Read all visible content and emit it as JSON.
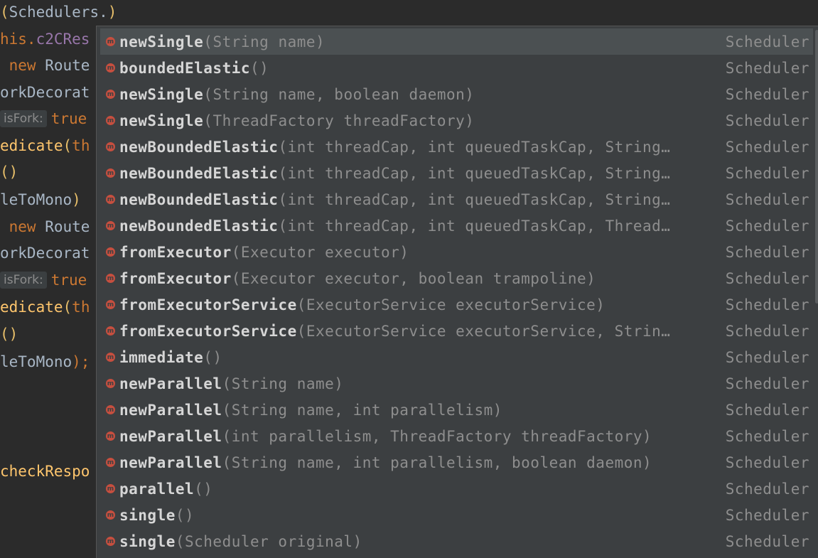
{
  "editor": {
    "lines": [
      {
        "id": "l1",
        "parts": [
          {
            "t": "(",
            "c": "c-paren"
          },
          {
            "t": "Schedulers.",
            "c": "c-plain"
          },
          {
            "t": ")",
            "c": "c-paren"
          }
        ]
      },
      {
        "id": "l2",
        "parts": [
          {
            "t": "his.",
            "c": "c-kw"
          },
          {
            "t": "c2CRes",
            "c": "c-field"
          }
        ]
      },
      {
        "id": "l3",
        "parts": [
          {
            "t": " new ",
            "c": "c-kw"
          },
          {
            "t": "Route",
            "c": "c-plain"
          }
        ]
      },
      {
        "id": "l4",
        "parts": [
          {
            "t": "orkDecorat",
            "c": "c-plain"
          }
        ]
      },
      {
        "id": "l5",
        "inlay": "isFork:",
        "parts": [
          {
            "t": "true",
            "c": "c-kw"
          }
        ]
      },
      {
        "id": "l6",
        "parts": [
          {
            "t": "edicate",
            "c": "c-method"
          },
          {
            "t": "(",
            "c": "c-paren"
          },
          {
            "t": "th",
            "c": "c-kw"
          }
        ]
      },
      {
        "id": "l7",
        "parts": [
          {
            "t": "()",
            "c": "c-paren"
          }
        ]
      },
      {
        "id": "l8",
        "parts": [
          {
            "t": "leToMono",
            "c": "c-plain"
          },
          {
            "t": ")",
            "c": "c-paren"
          }
        ]
      },
      {
        "id": "l9",
        "parts": [
          {
            "t": " new ",
            "c": "c-kw"
          },
          {
            "t": "Route",
            "c": "c-plain"
          }
        ]
      },
      {
        "id": "l10",
        "parts": [
          {
            "t": "orkDecorat",
            "c": "c-plain"
          }
        ]
      },
      {
        "id": "l11",
        "inlay": "isFork:",
        "parts": [
          {
            "t": "true",
            "c": "c-kw"
          }
        ]
      },
      {
        "id": "l12",
        "parts": [
          {
            "t": "edicate",
            "c": "c-method"
          },
          {
            "t": "(",
            "c": "c-paren"
          },
          {
            "t": "th",
            "c": "c-kw"
          }
        ]
      },
      {
        "id": "l13",
        "parts": [
          {
            "t": "()",
            "c": "c-paren"
          }
        ]
      },
      {
        "id": "l14",
        "parts": [
          {
            "t": "leToMono",
            "c": "c-plain"
          },
          {
            "t": ");",
            "c": "c-kw"
          }
        ]
      },
      {
        "id": "l15",
        "parts": [
          {
            "t": "checkRespo",
            "c": "c-method"
          }
        ]
      }
    ]
  },
  "completion": {
    "items": [
      {
        "name": "newSingle",
        "params": "(String name)",
        "type": "Scheduler",
        "selected": true
      },
      {
        "name": "boundedElastic",
        "params": "()",
        "type": "Scheduler"
      },
      {
        "name": "newSingle",
        "params": "(String name, boolean daemon)",
        "type": "Scheduler"
      },
      {
        "name": "newSingle",
        "params": "(ThreadFactory threadFactory)",
        "type": "Scheduler"
      },
      {
        "name": "newBoundedElastic",
        "params": "(int threadCap, int queuedTaskCap, String…",
        "type": "Scheduler"
      },
      {
        "name": "newBoundedElastic",
        "params": "(int threadCap, int queuedTaskCap, String…",
        "type": "Scheduler"
      },
      {
        "name": "newBoundedElastic",
        "params": "(int threadCap, int queuedTaskCap, String…",
        "type": "Scheduler"
      },
      {
        "name": "newBoundedElastic",
        "params": "(int threadCap, int queuedTaskCap, Thread…",
        "type": "Scheduler"
      },
      {
        "name": "fromExecutor",
        "params": "(Executor executor)",
        "type": "Scheduler"
      },
      {
        "name": "fromExecutor",
        "params": "(Executor executor, boolean trampoline)",
        "type": "Scheduler"
      },
      {
        "name": "fromExecutorService",
        "params": "(ExecutorService executorService)",
        "type": "Scheduler"
      },
      {
        "name": "fromExecutorService",
        "params": "(ExecutorService executorService, Strin…",
        "type": "Scheduler"
      },
      {
        "name": "immediate",
        "params": "()",
        "type": "Scheduler"
      },
      {
        "name": "newParallel",
        "params": "(String name)",
        "type": "Scheduler"
      },
      {
        "name": "newParallel",
        "params": "(String name, int parallelism)",
        "type": "Scheduler"
      },
      {
        "name": "newParallel",
        "params": "(int parallelism, ThreadFactory threadFactory)",
        "type": "Scheduler"
      },
      {
        "name": "newParallel",
        "params": "(String name, int parallelism, boolean daemon)",
        "type": "Scheduler"
      },
      {
        "name": "parallel",
        "params": "()",
        "type": "Scheduler"
      },
      {
        "name": "single",
        "params": "()",
        "type": "Scheduler"
      },
      {
        "name": "single",
        "params": "(Scheduler original)",
        "type": "Scheduler"
      }
    ],
    "icon": "method-icon",
    "icon_glyph": "m"
  }
}
